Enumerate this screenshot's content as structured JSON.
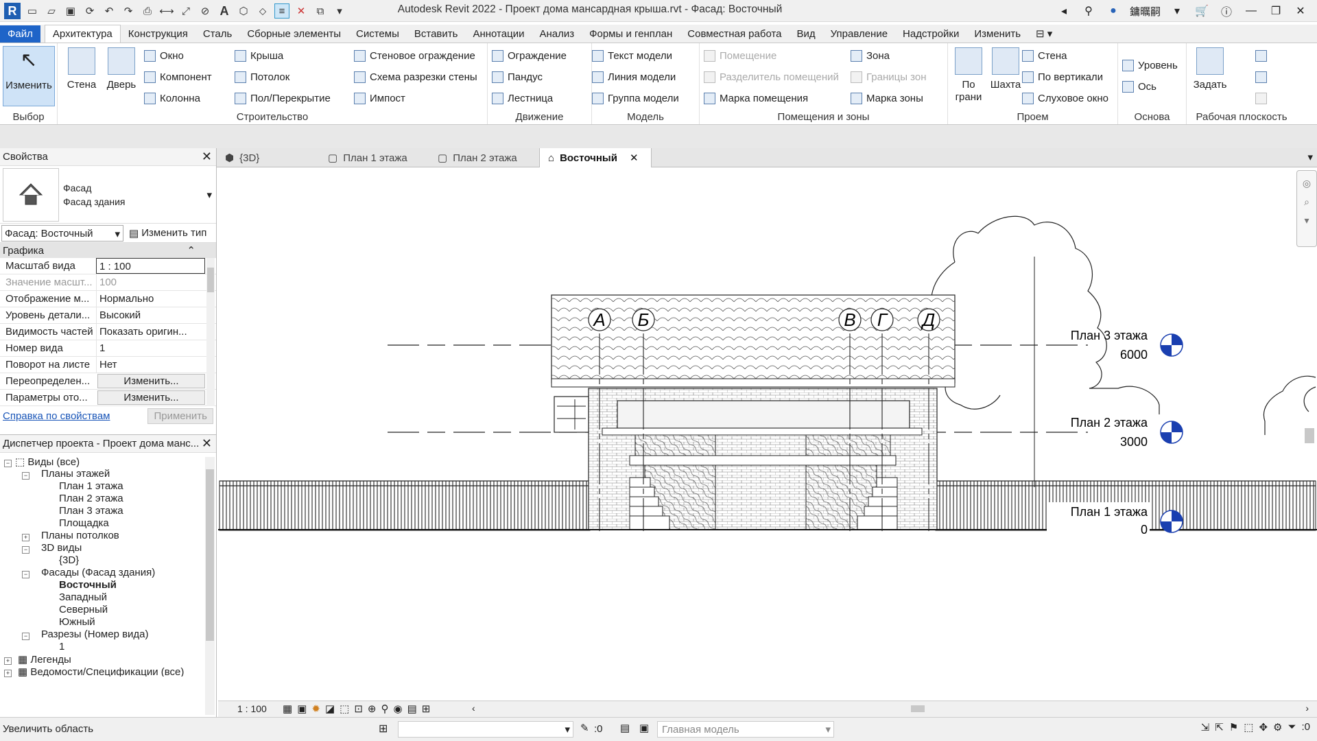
{
  "app": {
    "title": "Autodesk Revit 2022 - Проект дома мансардная крыша.rvt - Фасад: Восточный",
    "user": "鏞曞嗣",
    "logo": "R"
  },
  "tabs": [
    "Файл",
    "Архитектура",
    "Конструкция",
    "Сталь",
    "Сборные элементы",
    "Системы",
    "Вставить",
    "Аннотации",
    "Анализ",
    "Формы и генплан",
    "Совместная работа",
    "Вид",
    "Управление",
    "Надстройки",
    "Изменить"
  ],
  "ribbon": {
    "modify": "Изменить",
    "wall": "Стена",
    "door": "Дверь",
    "window": "Окно",
    "component": "Компонент",
    "column": "Колонна",
    "roof": "Крыша",
    "ceiling": "Потолок",
    "floor": "Пол/Перекрытие",
    "curtain_system": "Стеновое ограждение",
    "curtain_grid": "Схема разрезки стены",
    "mullion": "Импост",
    "railing": "Ограждение",
    "ramp": "Пандус",
    "stair": "Лестница",
    "model_text": "Текст модели",
    "model_line": "Линия модели",
    "model_group": "Группа модели",
    "room": "Помещение",
    "room_separator": "Разделитель помещений",
    "room_tag": "Марка помещения",
    "area": "Зона",
    "area_boundary": "Границы зон",
    "area_tag": "Марка зоны",
    "by_face": "По грани",
    "shaft": "Шахта",
    "op_wall": "Стена",
    "vertical": "По вертикали",
    "dormer": "Слуховое окно",
    "level": "Уровень",
    "grid": "Ось",
    "set": "Задать",
    "groups": {
      "select": "Выбор",
      "build": "Строительство",
      "circulation": "Движение",
      "model": "Модель",
      "room_area": "Помещения и зоны",
      "opening": "Проем",
      "datum": "Основа",
      "work_plane": "Рабочая плоскость"
    }
  },
  "properties": {
    "title": "Свойства",
    "family": "Фасад",
    "type": "Фасад здания",
    "selector": "Фасад: Восточный",
    "edit_type": "Изменить тип",
    "section": "Графика",
    "rows": [
      {
        "k": "Масштаб вида",
        "v": "1 : 100"
      },
      {
        "k": "Значение масшт...",
        "v": "100"
      },
      {
        "k": "Отображение м...",
        "v": "Нормально"
      },
      {
        "k": "Уровень детали...",
        "v": "Высокий"
      },
      {
        "k": "Видимость частей",
        "v": "Показать оригин..."
      },
      {
        "k": "Номер вида",
        "v": "1"
      },
      {
        "k": "Поворот на листе",
        "v": "Нет"
      },
      {
        "k": "Переопределен...",
        "v": "Изменить..."
      },
      {
        "k": "Параметры ото...",
        "v": "Изменить..."
      }
    ],
    "help": "Справка по свойствам",
    "apply": "Применить"
  },
  "browser": {
    "title": "Диспетчер проекта - Проект дома манс...",
    "items": [
      "Виды (все)",
      "Планы этажей",
      "План 1 этажа",
      "План 2 этажа",
      "План 3 этажа",
      "Площадка",
      "Планы потолков",
      "3D виды",
      "{3D}",
      "Фасады (Фасад здания)",
      "Восточный",
      "Западный",
      "Северный",
      "Южный",
      "Разрезы (Номер вида)",
      "1",
      "Легенды",
      "Ведомости/Спецификации (все)"
    ]
  },
  "view_tabs": [
    "{3D}",
    "План 1 этажа",
    "План 2 этажа",
    "Восточный"
  ],
  "drawing": {
    "grids": [
      "А",
      "Б",
      "В",
      "Г",
      "Д"
    ],
    "levels": [
      {
        "name": "План 3 этажа",
        "elev": "6000"
      },
      {
        "name": "План 2 этажа",
        "elev": "3000"
      },
      {
        "name": "План 1 этажа",
        "elev": "0"
      }
    ]
  },
  "viewbar": {
    "scale": "1 : 100"
  },
  "status": {
    "text": "Увеличить область",
    "sel_count": ":0",
    "model": "Главная модель",
    "filter": ":0"
  }
}
